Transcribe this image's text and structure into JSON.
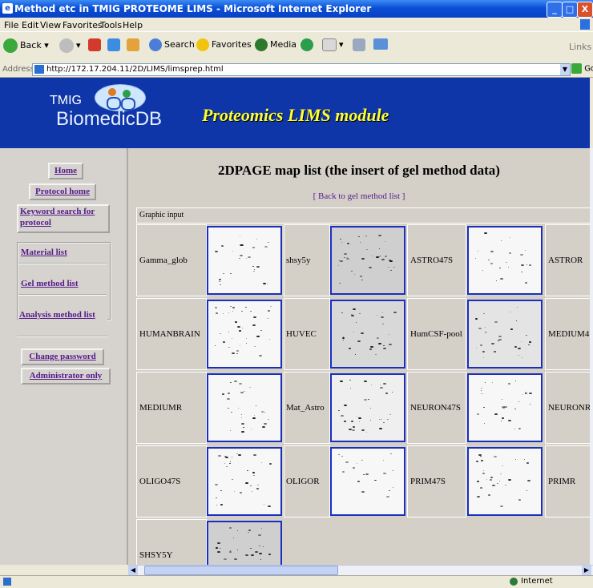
{
  "window": {
    "title": "Method etc in TMIG PROTEOME LIMS - Microsoft Internet Explorer",
    "controls": {
      "minimize": "_",
      "maximize": "□",
      "close": "X"
    }
  },
  "menu": [
    "File",
    "Edit",
    "View",
    "Favorites",
    "Tools",
    "Help"
  ],
  "toolbar": {
    "back": "Back",
    "search": "Search",
    "favorites": "Favorites",
    "media": "Media",
    "links": "Links"
  },
  "address": {
    "label": "Address",
    "url": "http://172.17.204.11/2D/LIMS/limsprep.html",
    "go": "Go"
  },
  "header": {
    "logo_top": "TMIG",
    "logo_bottom": "BiomedicDB",
    "title": "Proteomics LIMS module"
  },
  "nav": {
    "home": "Home",
    "protocol_home": "Protocol home",
    "keyword_search": "Keyword search for protocol",
    "material_list": "Material list",
    "gel_method_list": "Gel method list",
    "analysis_method_list": "Analysis method list",
    "change_password": "Change password",
    "administrator_only": "Administrator only"
  },
  "content": {
    "title": "2DPAGE map list (the insert of gel method data)",
    "back_link": "[ Back to gel method list ]",
    "graphic_input": "Graphic input",
    "maps": [
      "Gamma_glob",
      "shsy5y",
      "ASTRO47S",
      "ASTROR",
      "HUMANBRAIN",
      "HUVEC",
      "HumCSF-pool",
      "MEDIUM4",
      "MEDIUMR",
      "Mat_Astro",
      "NEURON47S",
      "NEURONR",
      "OLIGO47S",
      "OLIGOR",
      "PRIM47S",
      "PRIMR",
      "SHSY5Y"
    ]
  },
  "status": {
    "zone": "Internet"
  },
  "icons": {
    "back": "back-arrow-icon",
    "forward": "forward-arrow-icon",
    "stop": "stop-icon",
    "refresh": "refresh-icon",
    "home": "home-icon",
    "search": "search-icon",
    "favorites": "star-icon",
    "media": "media-icon",
    "history": "history-icon",
    "mail": "mail-icon",
    "print": "print-icon",
    "edit": "edit-icon"
  }
}
